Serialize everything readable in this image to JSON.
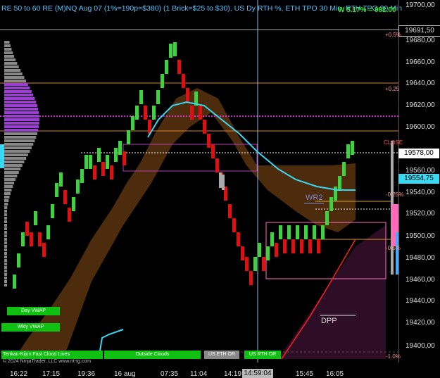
{
  "header": {
    "title": "RE 50 to 60 RE (M)NQ Aug 07 (1%=190p=$380) (1 Brick=$25 to $30), US Dy RTH %, ETH TPO 30 Min, RTH TPO 30 Min",
    "pnl": "W 5.17% = 982.00"
  },
  "price_axis": {
    "labels": [
      "19700,00",
      "19680,00",
      "19660,00",
      "19640,00",
      "19620,00",
      "19600,00",
      "19560,00",
      "19540,00",
      "19520,00",
      "19500,00",
      "19480,00",
      "19460,00",
      "19440,00",
      "19420,00",
      "19400,00"
    ],
    "top_box": "19691,50",
    "current_box": "19578,00",
    "vwap_box": "19554,75"
  },
  "time_axis": {
    "labels": [
      "16:22",
      "17:15",
      "19:36",
      "16 aug",
      "07:35",
      "11:04",
      "14:19",
      "15:45",
      "16:05"
    ],
    "cursor_time": "14:59:04"
  },
  "levels": {
    "p05": "+0.5%",
    "p025": "+0.25",
    "close": "CLOSE",
    "m025": "-0.25%",
    "m05": "-0.5%",
    "m1": "-1.0%"
  },
  "annotations": {
    "wr2": "WR2",
    "dpp": "DPP"
  },
  "buttons": {
    "day_vwap": "Day VWAP",
    "wkly_vwap": "Wkly VWAP",
    "tenkan_kijun": "Tenkan-Kijun Fast Cloud Lines",
    "outside_clouds": "Outside Clouds",
    "us_eth_or": "US ETH OR",
    "us_rth_or": "US RTH OR"
  },
  "copyright": "© 2024 NinjaTrader, LLC  www.nt-tg.com",
  "colors": {
    "up": "#3fd13f",
    "down": "#e01010",
    "vwap": "#39d8f0",
    "cloud": "#5a3410",
    "poc": "#ff33ff"
  }
}
